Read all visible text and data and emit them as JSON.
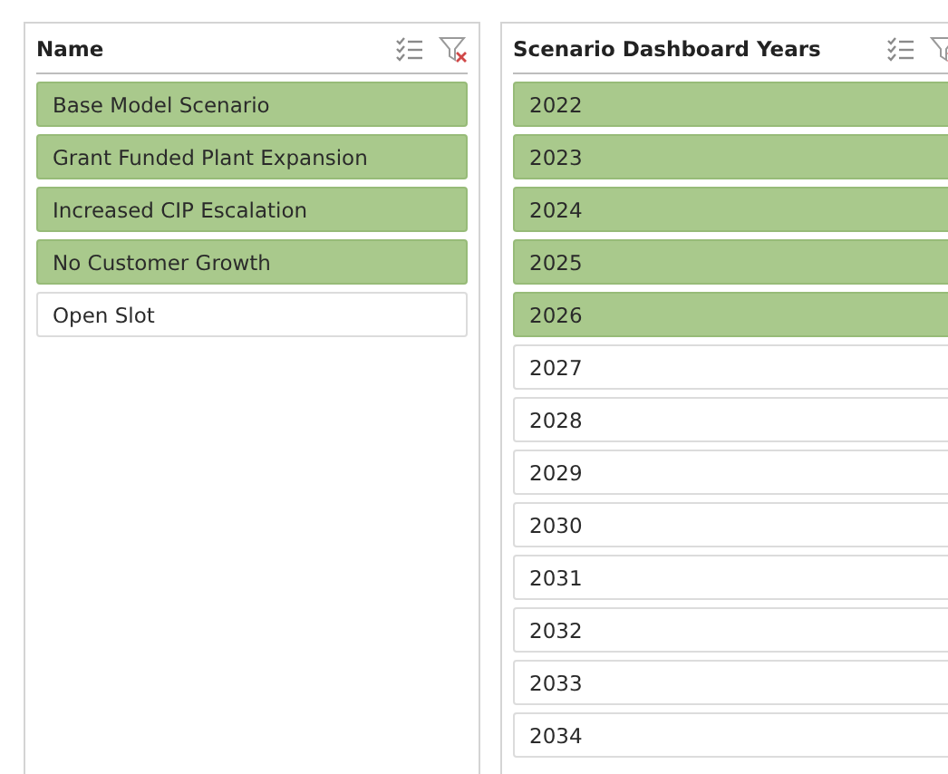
{
  "slicers": [
    {
      "title": "Name",
      "items": [
        {
          "label": "Base Model Scenario",
          "selected": true
        },
        {
          "label": "Grant Funded Plant Expansion",
          "selected": true
        },
        {
          "label": "Increased CIP Escalation",
          "selected": true
        },
        {
          "label": "No Customer Growth",
          "selected": true
        },
        {
          "label": "Open Slot",
          "selected": false
        }
      ]
    },
    {
      "title": "Scenario Dashboard Years",
      "items": [
        {
          "label": "2022",
          "selected": true
        },
        {
          "label": "2023",
          "selected": true
        },
        {
          "label": "2024",
          "selected": true
        },
        {
          "label": "2025",
          "selected": true
        },
        {
          "label": "2026",
          "selected": true
        },
        {
          "label": "2027",
          "selected": false
        },
        {
          "label": "2028",
          "selected": false
        },
        {
          "label": "2029",
          "selected": false
        },
        {
          "label": "2030",
          "selected": false
        },
        {
          "label": "2031",
          "selected": false
        },
        {
          "label": "2032",
          "selected": false
        },
        {
          "label": "2033",
          "selected": false
        },
        {
          "label": "2034",
          "selected": false
        }
      ]
    }
  ]
}
